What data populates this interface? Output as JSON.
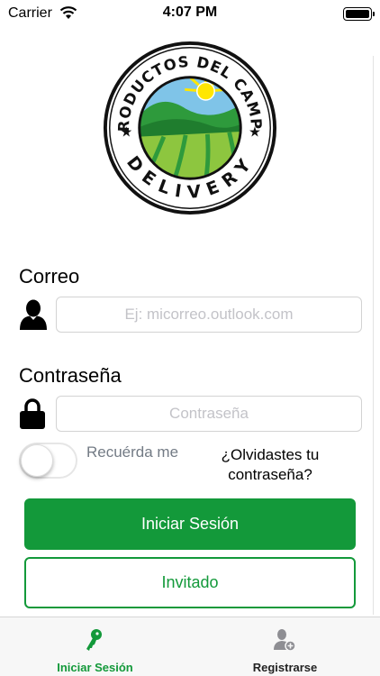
{
  "status_bar": {
    "carrier": "Carrier",
    "time": "4:07 PM",
    "icons": [
      "wifi-icon",
      "battery-icon"
    ]
  },
  "logo": {
    "top_text": "PRODUCTOS DEL CAMPO",
    "bottom_text": "DELIVERY",
    "colors": {
      "green": "#2e9a3c",
      "light_green": "#8dc63f",
      "sky": "#7fc4e8",
      "sun": "#ffe600"
    }
  },
  "form": {
    "email_label": "Correo",
    "email_placeholder": "Ej: micorreo.outlook.com",
    "email_value": "",
    "password_label": "Contraseña",
    "password_placeholder": "Contraseña",
    "password_value": "",
    "remember_label": "Recuérda me",
    "remember_on": false,
    "forgot_label": "¿Olvidastes tu contraseña?"
  },
  "buttons": {
    "login": "Iniciar Sesión",
    "guest": "Invitado"
  },
  "tab_bar": {
    "tabs": [
      {
        "label": "Iniciar Sesión",
        "icon": "key-icon",
        "selected": true
      },
      {
        "label": "Registrarse",
        "icon": "add-user-icon",
        "selected": false
      }
    ]
  },
  "colors": {
    "accent": "#13993a",
    "placeholder": "#c3c3c8",
    "secondary_text": "#737b85"
  }
}
